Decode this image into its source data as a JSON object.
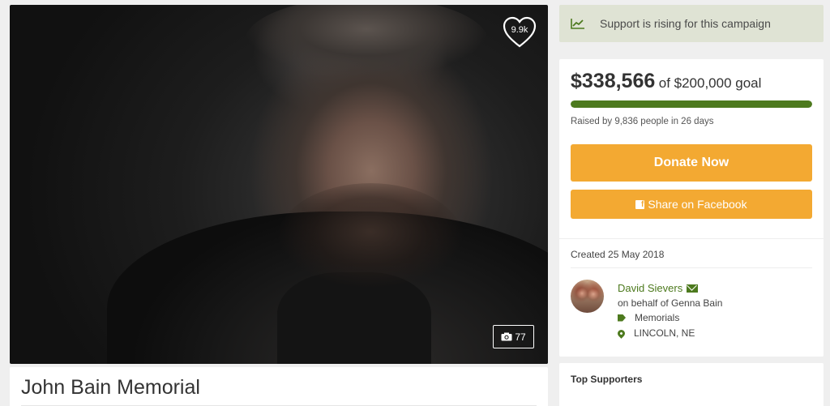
{
  "hero": {
    "heart_count": "9.9k",
    "photo_count": "77",
    "icons": [
      "heart-icon",
      "camera-icon"
    ]
  },
  "campaign": {
    "title": "John Bain Memorial"
  },
  "rising_banner": {
    "text": "Support is rising for this campaign",
    "icon": "trending-up-icon"
  },
  "donation": {
    "amount": "$338,566",
    "goal_text": "of $200,000 goal",
    "progress_percent": 100,
    "raised_by": "Raised by 9,836 people in 26 days",
    "donate_label": "Donate Now",
    "share_label": "Share on Facebook",
    "accent_color": "#f3a932",
    "progress_color": "#4d7a1e"
  },
  "details": {
    "created": "Created 25 May 2018",
    "organizer_name": "David Sievers",
    "on_behalf": "on behalf of Genna Bain",
    "category": "Memorials",
    "location": "LINCOLN, NE"
  },
  "supporters": {
    "heading": "Top Supporters"
  }
}
